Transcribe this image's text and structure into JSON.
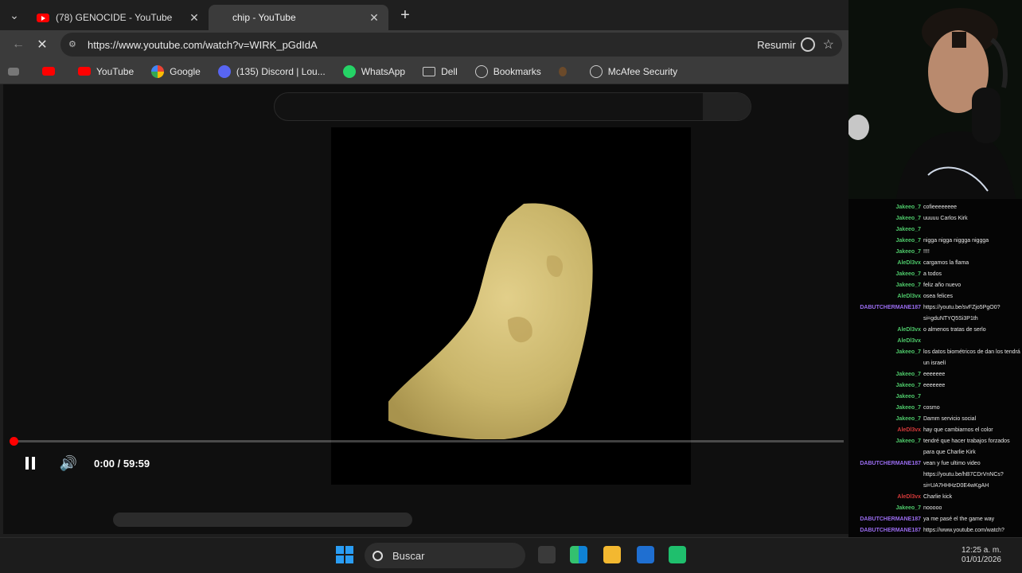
{
  "tabs": [
    {
      "title": "(78) GENOCIDE - YouTube",
      "active": false
    },
    {
      "title": "chip - YouTube",
      "active": true
    }
  ],
  "address": {
    "url": "https://www.youtube.com/watch?v=WIRK_pGdIdA",
    "summarize": "Resumir"
  },
  "bookmarks": [
    "YouTube",
    "Google",
    "(135) Discord | Lou...",
    "WhatsApp",
    "Dell",
    "Bookmarks",
    "McAfee Security"
  ],
  "player": {
    "time": "0:00 / 59:59",
    "progress_fraction": 0.0,
    "state": "playing"
  },
  "chat": [
    {
      "user": "Jakeeo_7",
      "color": "#4ec96a",
      "text": "cofieeeeeeee"
    },
    {
      "user": "Jakeeo_7",
      "color": "#4ec96a",
      "text": "uuuuu Carlos Kirk"
    },
    {
      "user": "Jakeeo_7",
      "color": "#4ec96a",
      "text": ""
    },
    {
      "user": "Jakeeo_7",
      "color": "#4ec96a",
      "text": "nigga nigga niggga niggga"
    },
    {
      "user": "Jakeeo_7",
      "color": "#4ec96a",
      "text": "!!!!"
    },
    {
      "user": "AleDl3vx",
      "color": "#4ec96a",
      "text": "cargamos la flama"
    },
    {
      "user": "Jakeeo_7",
      "color": "#4ec96a",
      "text": "a todos"
    },
    {
      "user": "Jakeeo_7",
      "color": "#4ec96a",
      "text": "feliz año nuevo"
    },
    {
      "user": "AleDl3vx",
      "color": "#4ec96a",
      "text": "osea felices"
    },
    {
      "user": "DABUTCHERMANE187",
      "color": "#9a6cf0",
      "text": "https://youtu.be/svFZjo5PgO0?"
    },
    {
      "user": "",
      "color": "#9a6cf0",
      "text": "si=gduNTYQ5Si3P1th"
    },
    {
      "user": "AleDl3vx",
      "color": "#4ec96a",
      "text": "o almenos tratas de serlo"
    },
    {
      "user": "AleDl3vx",
      "color": "#4ec96a",
      "text": ""
    },
    {
      "user": "Jakeeo_7",
      "color": "#4ec96a",
      "text": "los datos biométricos de dan los tendrá"
    },
    {
      "user": "",
      "color": "#4ec96a",
      "text": "un israelí"
    },
    {
      "user": "Jakeeo_7",
      "color": "#4ec96a",
      "text": "eeeeeee"
    },
    {
      "user": "Jakeeo_7",
      "color": "#4ec96a",
      "text": "eeeeeee"
    },
    {
      "user": "Jakeeo_7",
      "color": "#4ec96a",
      "text": ""
    },
    {
      "user": "Jakeeo_7",
      "color": "#4ec96a",
      "text": "cosmo"
    },
    {
      "user": "Jakeeo_7",
      "color": "#4ec96a",
      "text": "Damm servicio social"
    },
    {
      "user": "AleDl3vx",
      "color": "#d53a3a",
      "text": "hay que cambiarnos el color"
    },
    {
      "user": "Jakeeo_7",
      "color": "#4ec96a",
      "text": "tendré que hacer trabajos forzados"
    },
    {
      "user": "",
      "color": "#4ec96a",
      "text": "para que Charlie Kirk"
    },
    {
      "user": "DABUTCHERMANE187",
      "color": "#9a6cf0",
      "text": "vean y fue ultimo video"
    },
    {
      "user": "",
      "color": "#9a6cf0",
      "text": "https://youtu.be/hB7CDrVnNCs?"
    },
    {
      "user": "",
      "color": "#9a6cf0",
      "text": "si=UA7HHHzD0E4wKgAH"
    },
    {
      "user": "AleDl3vx",
      "color": "#d53a3a",
      "text": "Charlie kick"
    },
    {
      "user": "Jakeeo_7",
      "color": "#4ec96a",
      "text": "nooooo"
    },
    {
      "user": "DABUTCHERMANE187",
      "color": "#9a6cf0",
      "text": "ya me pasé el the game way"
    },
    {
      "user": "DABUTCHERMANE187",
      "color": "#9a6cf0",
      "text": "https://www.youtube.com/watch?"
    }
  ],
  "taskbar": {
    "search": "Buscar",
    "time": "12:25 a. m.",
    "date": "01/01/2026"
  },
  "colors": {
    "accent": "#ff0000",
    "tab_bg": "#1f1f1f",
    "toolbar_bg": "#3b3b3b"
  }
}
